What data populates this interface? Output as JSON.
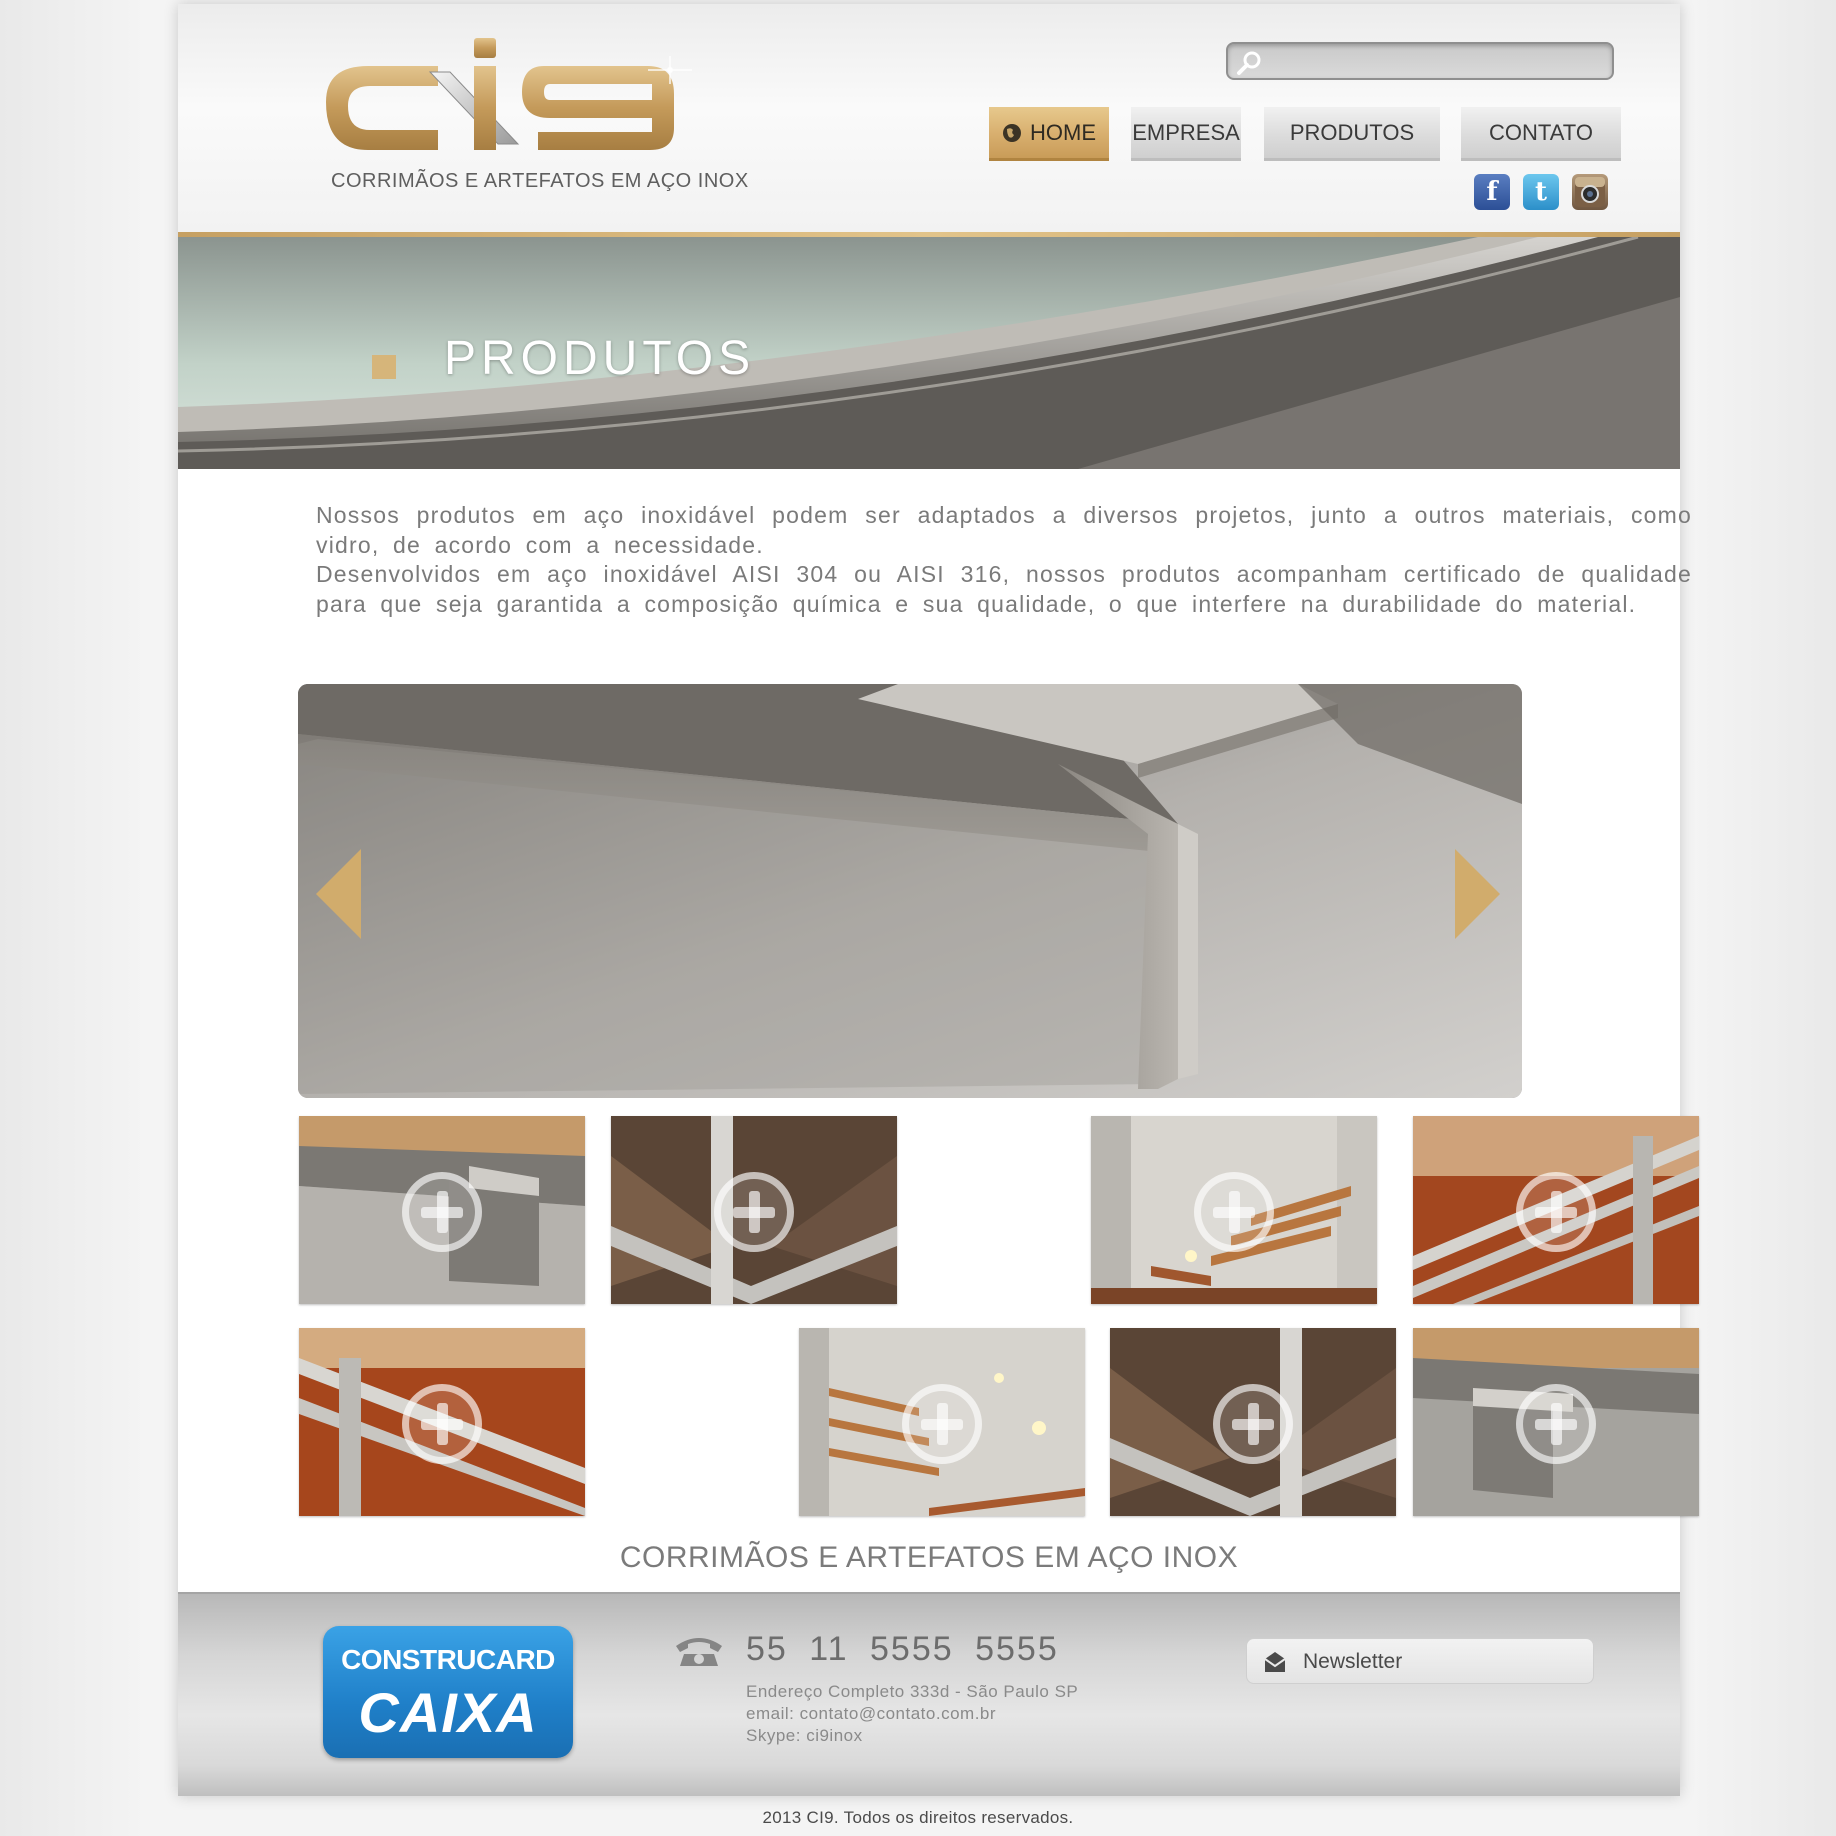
{
  "brand": {
    "logo_text": "ci9",
    "tagline": "CORRIMÃOS E ARTEFATOS EM AÇO INOX"
  },
  "search": {
    "placeholder": "",
    "value": ""
  },
  "nav": {
    "items": [
      {
        "label": "HOME",
        "active": true
      },
      {
        "label": "EMPRESA",
        "active": false
      },
      {
        "label": "PRODUTOS",
        "active": false
      },
      {
        "label": "CONTATO",
        "active": false
      }
    ]
  },
  "social": {
    "facebook_glyph": "f",
    "twitter_glyph": "t",
    "icons": [
      "facebook-icon",
      "twitter-icon",
      "instagram-icon"
    ]
  },
  "banner": {
    "title": "PRODUTOS"
  },
  "intro": {
    "paragraph1": "Nossos produtos em aço inoxidável podem ser adaptados a diversos projetos, junto a outros materiais, como vidro, de acordo com a necessidade.",
    "paragraph2": "Desenvolvidos em aço inoxidável AISI 304 ou AISI 316, nossos produtos acompanham certificado de qualidade para que seja garantida a composição química e sua qualidade, o que interfere na durabilidade do material."
  },
  "gallery": {
    "thumbnails_count": 8
  },
  "section_tagline": "CORRIMÃOS E ARTEFATOS EM AÇO INOX",
  "footer": {
    "partner_top": "CONSTRUCARD",
    "partner_bottom": "CAIXA",
    "phone": "55 11 5555 5555",
    "address": "Endereço Completo 333d - São Paulo SP",
    "email": "email: contato@contato.com.br",
    "skype": "Skype: ci9inox",
    "newsletter_label": "Newsletter"
  },
  "copyright": "2013 CI9. Todos os direitos reservados.",
  "colors": {
    "gold": "#d6b57a",
    "footer_gray": "#d5d5d5",
    "caixa_blue": "#1f7fc8"
  }
}
